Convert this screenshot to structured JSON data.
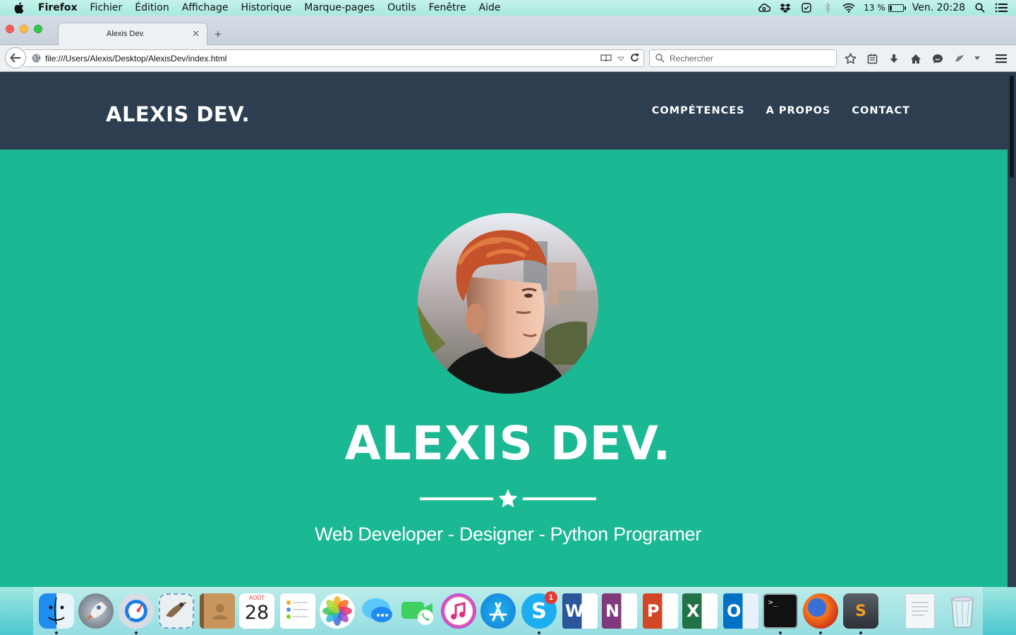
{
  "menubar": {
    "app": "Firefox",
    "items": [
      "Fichier",
      "Édition",
      "Affichage",
      "Historique",
      "Marque-pages",
      "Outils",
      "Fenêtre",
      "Aide"
    ],
    "battery_percent": "13 %",
    "clock": "Ven. 20:28"
  },
  "browser": {
    "tab_title": "Alexis Dev.",
    "url": "file:///Users/Alexis/Desktop/AlexisDev/index.html",
    "search_placeholder": "Rechercher"
  },
  "site": {
    "brand": "ALEXIS DEV.",
    "nav": [
      "COMPÉTENCES",
      "A PROPOS",
      "CONTACT"
    ],
    "hero_title": "ALEXIS DEV.",
    "hero_subtitle": "Web Developer - Designer - Python Programer",
    "colors": {
      "header": "#2c3e50",
      "hero": "#1bb894",
      "text": "#ffffff"
    }
  },
  "dock": {
    "apps": [
      "finder",
      "launchpad",
      "safari",
      "mail",
      "contacts",
      "calendar",
      "reminders",
      "photos",
      "messages",
      "facetime",
      "itunes",
      "app-store",
      "skype",
      "word",
      "onenote",
      "powerpoint",
      "excel",
      "outlook",
      "terminal",
      "firefox",
      "sublime-text"
    ],
    "calendar_month": "AOÛT",
    "calendar_day": "28",
    "skype_badge": "1"
  }
}
